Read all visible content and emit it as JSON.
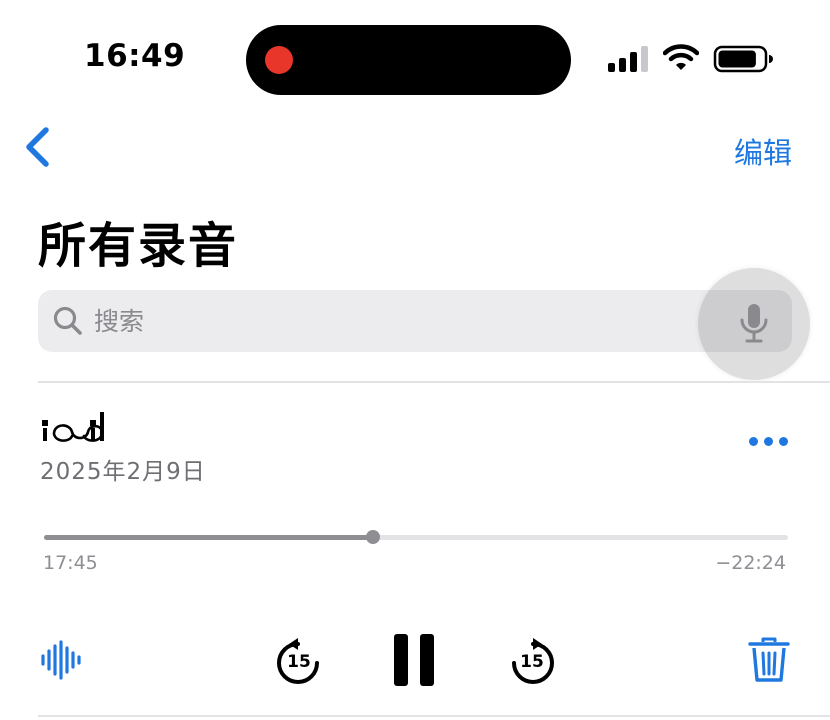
{
  "status_bar": {
    "time": "16:49",
    "recording_indicator_color": "#e8362a",
    "signal_bars_active": 3,
    "signal_bars_total": 4,
    "battery_level": 0.85,
    "icons": [
      "cellular-signal-icon",
      "wifi-icon",
      "battery-icon"
    ]
  },
  "nav": {
    "back_icon": "chevron-left-icon",
    "edit_label": "编辑"
  },
  "page_title": "所有录音",
  "search": {
    "placeholder": "搜索",
    "value": "",
    "search_icon": "magnifying-glass-icon",
    "voice_icon": "microphone-icon"
  },
  "recording": {
    "title": "",
    "date": "2025年2月9日",
    "more_icon": "ellipsis-icon",
    "progress": 0.442,
    "elapsed": "17:45",
    "remaining": "−22:24"
  },
  "controls": {
    "waveform_icon": "waveform-icon",
    "skip_back_label": "15",
    "skip_back_icon": "skip-back-15-icon",
    "pause_icon": "pause-icon",
    "skip_forward_label": "15",
    "skip_forward_icon": "skip-forward-15-icon",
    "delete_icon": "trash-icon"
  },
  "colors": {
    "accent": "#1f78e0",
    "text_primary": "#000000",
    "text_secondary": "#6e6e73",
    "text_tertiary": "#8e8e93",
    "search_background": "#ececee",
    "divider": "#e3e3e6"
  }
}
